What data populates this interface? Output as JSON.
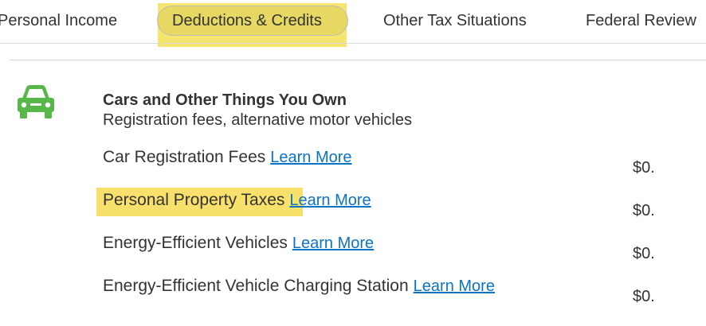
{
  "nav": {
    "tabs": [
      {
        "label": "Personal Income"
      },
      {
        "label": "Deductions & Credits"
      },
      {
        "label": "Other Tax Situations"
      },
      {
        "label": "Federal Review"
      }
    ]
  },
  "section": {
    "icon": "car-icon",
    "icon_color": "#57b849",
    "title": "Cars and Other Things You Own",
    "subtitle": "Registration fees, alternative motor vehicles",
    "items": [
      {
        "label": "Car Registration Fees",
        "link": "Learn More",
        "amount": "$0."
      },
      {
        "label": "Personal Property Taxes",
        "link": "Learn More",
        "amount": "$0."
      },
      {
        "label": "Energy-Efficient Vehicles",
        "link": "Learn More",
        "amount": "$0."
      },
      {
        "label": "Energy-Efficient Vehicle Charging Station",
        "link": "Learn More",
        "amount": "$0."
      }
    ]
  },
  "colors": {
    "link": "#0b74c4",
    "highlight": "#f5e66d"
  }
}
